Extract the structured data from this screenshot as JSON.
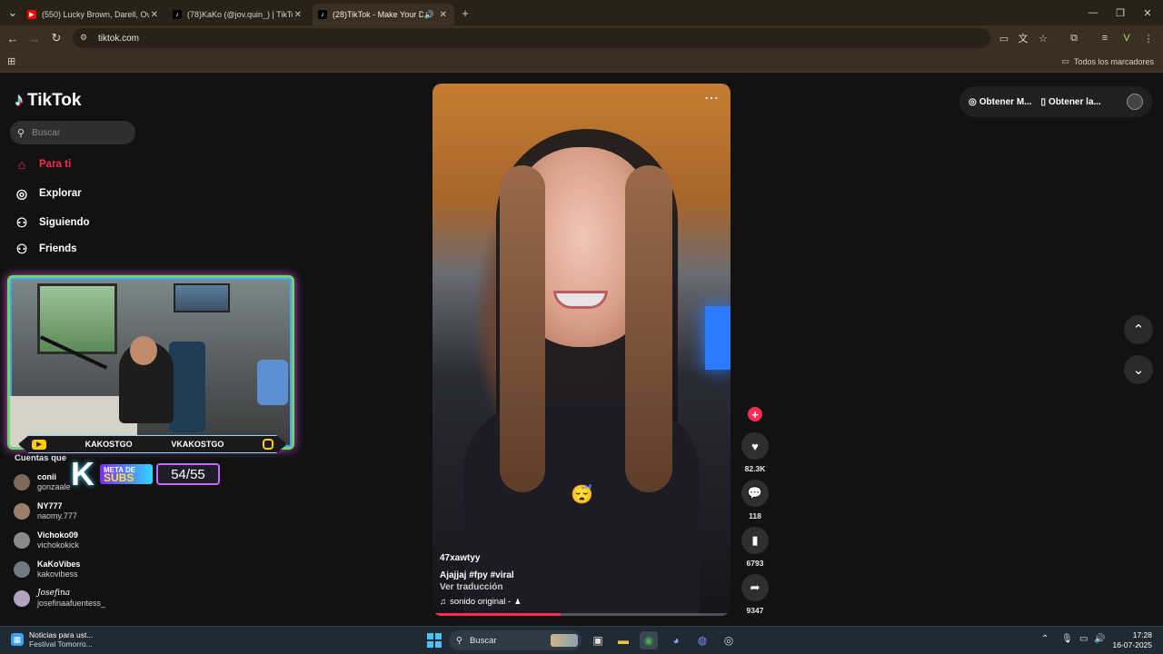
{
  "browser": {
    "tabs": [
      {
        "title": "(550) Lucky Brown, Darell, Ovy",
        "favicon": "youtube-icon"
      },
      {
        "title": "(78)KaKo (@jov.quin_) | TikTok",
        "favicon": "tiktok-icon"
      },
      {
        "title": "(28)TikTok - Make Your Day",
        "favicon": "tiktok-icon",
        "active": true
      }
    ],
    "url": "tiktok.com",
    "bookmarks_all": "Todos los marcadores"
  },
  "tiktok": {
    "logo": "TikTok",
    "search_placeholder": "Buscar",
    "nav": [
      {
        "label": "Para ti",
        "icon": "home-icon",
        "active": true
      },
      {
        "label": "Explorar",
        "icon": "compass-icon"
      },
      {
        "label": "Siguiendo",
        "icon": "user-follow-icon"
      },
      {
        "label": "Friends",
        "icon": "friends-icon"
      }
    ],
    "accounts_title": "Cuentas que",
    "accounts": [
      {
        "name": "conii",
        "handle": "gonzaale"
      },
      {
        "name": "NY777",
        "handle": "naomy.777"
      },
      {
        "name": "Vichoko09",
        "handle": "vichokokick"
      },
      {
        "name": "KaKoVibes",
        "handle": "kakovibess"
      },
      {
        "name": "Josefina",
        "handle": "josefinaafuentess_"
      }
    ],
    "top_buttons": {
      "coins": "Obtener M...",
      "app": "Obtener la..."
    },
    "video": {
      "username": "47xawtyy",
      "description": "Ajajjaj #fpy  #viral",
      "translate": "Ver traducción",
      "sound": "sonido original -",
      "progress": 0.43
    },
    "actions": {
      "likes": "82.3K",
      "comments": "118",
      "saves": "6793",
      "shares": "9347"
    }
  },
  "stream_overlay": {
    "left_handle": "KAKOSTGO",
    "right_handle": "VKAKOSTGO",
    "goal_label_top": "META DE",
    "goal_label_bottom": "SUBS",
    "goal_count": "54/55"
  },
  "taskbar": {
    "news_title": "Noticias para ust...",
    "news_sub": "Festival Tomorro...",
    "search": "Buscar",
    "time": "17:28",
    "date": "16-07-2025"
  },
  "colors": {
    "accent": "#fe2c55",
    "browser_chrome": "#3b2f22",
    "taskbar": "#1f2a33"
  }
}
